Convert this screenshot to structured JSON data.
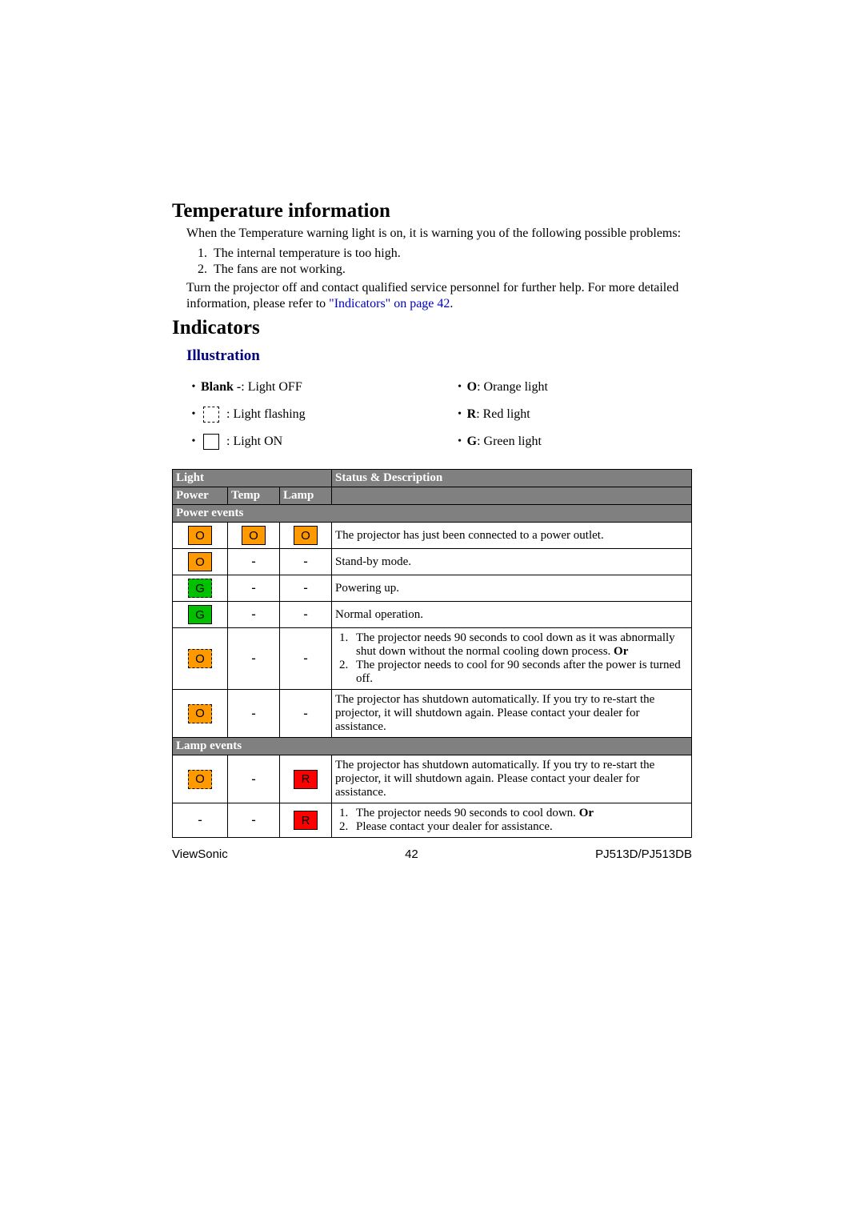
{
  "headings": {
    "temp_info": "Temperature information",
    "indicators": "Indicators",
    "illustration": "Illustration"
  },
  "temp_para1": "When the Temperature warning light is on, it is warning you of the following possible problems:",
  "temp_list": {
    "item1": "The internal temperature is too high.",
    "item2": "The fans are not working."
  },
  "temp_para2_a": "Turn the projector off and contact qualified service personnel for further help. For more detailed information, please refer to ",
  "temp_para2_link": "\"Indicators\" on page 42",
  "temp_para2_b": ".",
  "legend": {
    "blank_label": "Blank -",
    "blank_desc": ": Light OFF",
    "flash_desc": " : Light flashing",
    "on_desc": " : Light ON",
    "o_label": "O",
    "o_desc": ": Orange light",
    "r_label": "R",
    "r_desc": ": Red light",
    "g_label": "G",
    "g_desc": ": Green light"
  },
  "table": {
    "head_light": "Light",
    "head_status": "Status & Description",
    "col_power": "Power",
    "col_temp": "Temp",
    "col_lamp": "Lamp",
    "section_power": "Power events",
    "section_lamp": "Lamp events",
    "letter_O": "O",
    "letter_G": "G",
    "letter_R": "R",
    "dash": "-",
    "row1_desc": "The projector has just been connected to a power outlet.",
    "row2_desc": "Stand-by mode.",
    "row3_desc": "Powering up.",
    "row4_desc": "Normal operation.",
    "row5_item1_a": "The projector needs 90 seconds to cool down as it was abnormally shut down without the normal cooling down process. ",
    "row5_item1_b": "Or",
    "row5_item2": "The projector needs to cool for 90 seconds after the power is turned off.",
    "row6_desc": "The projector has shutdown automatically. If you try to re-start the projector, it will shutdown again. Please contact your dealer for assistance.",
    "row7_desc": "The projector has shutdown automatically. If you try to re-start the projector, it will shutdown again. Please contact your dealer for assistance.",
    "row8_item1_a": "The projector needs 90 seconds to cool down. ",
    "row8_item1_b": "Or",
    "row8_item2": "Please contact your dealer for assistance."
  },
  "footer": {
    "brand": "ViewSonic",
    "page": "42",
    "model": "PJ513D/PJ513DB"
  }
}
